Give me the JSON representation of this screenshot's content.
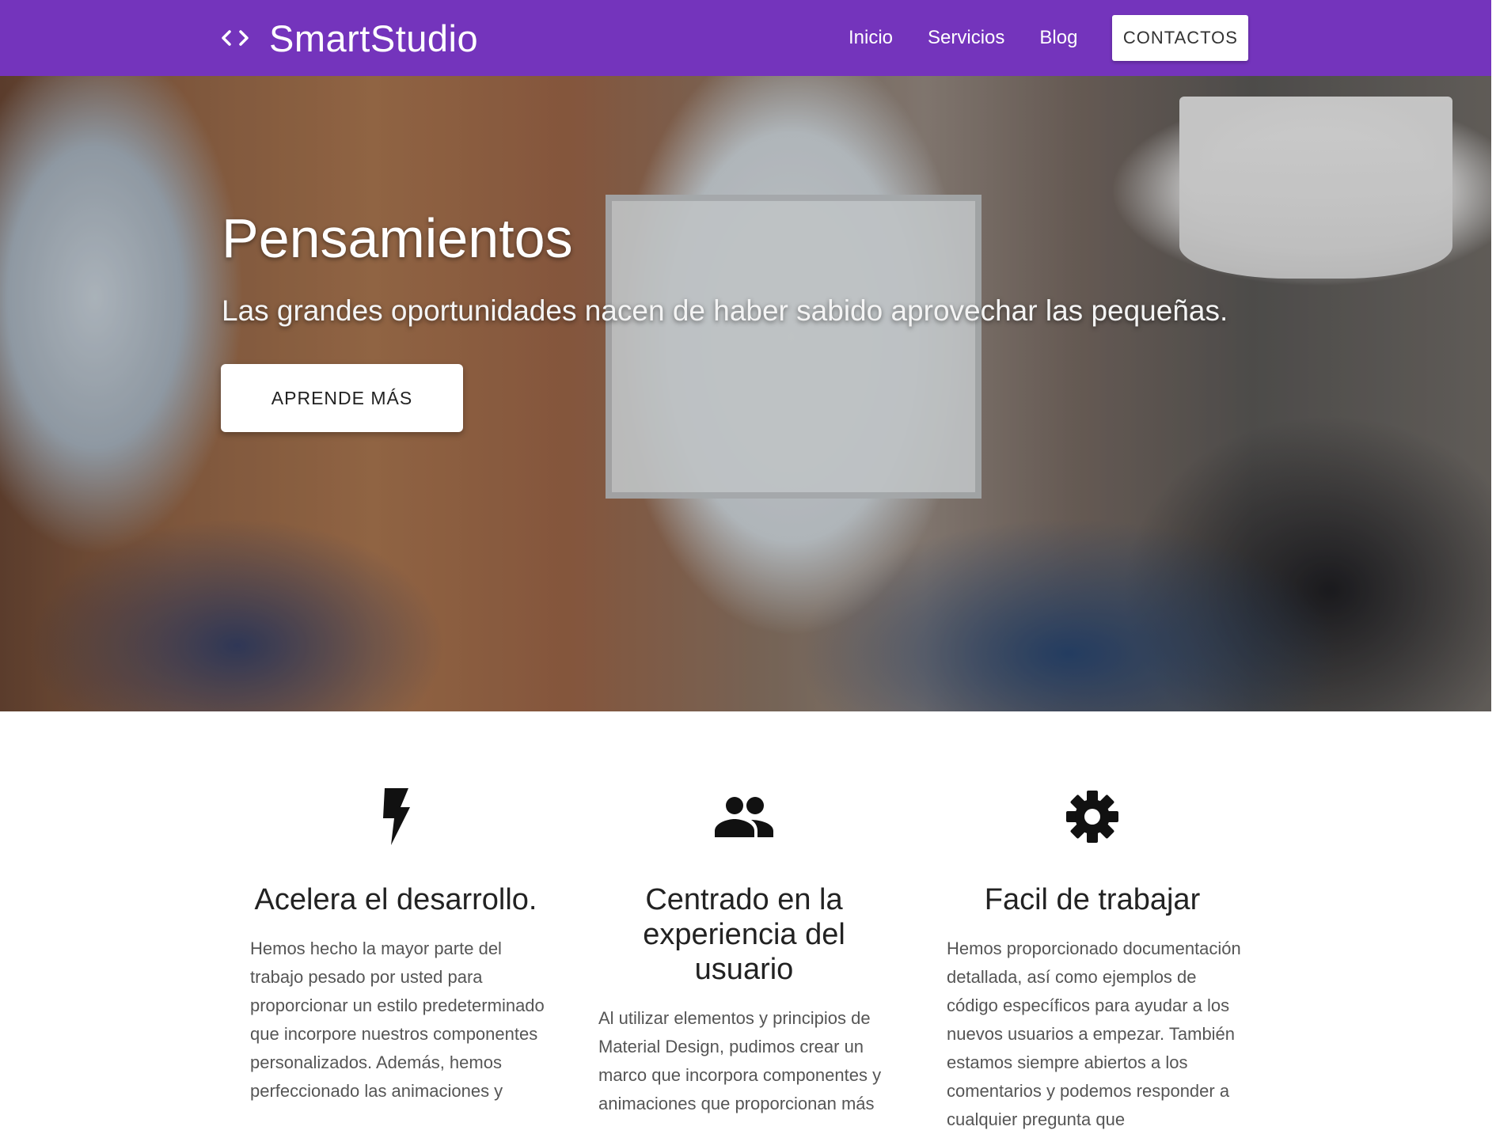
{
  "nav": {
    "brand_name": "SmartStudio",
    "brand_icon": "code-icon",
    "links": [
      "Inicio",
      "Servicios",
      "Blog"
    ],
    "cta_label": "CONTACTOS",
    "background_color": "#7434bc"
  },
  "hero": {
    "title": "Pensamientos",
    "subtitle": "Las grandes oportunidades nacen de haber sabido aprovechar las pequeñas.",
    "button_label": "APRENDE MÁS"
  },
  "features": [
    {
      "icon": "bolt-icon",
      "title": "Acelera el desarrollo.",
      "text": "Hemos hecho la mayor parte del trabajo pesado por usted para proporcionar un estilo predeterminado que incorpore nuestros componentes personalizados. Además, hemos perfeccionado las animaciones y"
    },
    {
      "icon": "group-icon",
      "title": "Centrado en la experiencia del usuario",
      "text": "Al utilizar elementos y principios de Material Design, pudimos crear un marco que incorpora componentes y animaciones que proporcionan más"
    },
    {
      "icon": "gear-icon",
      "title": "Facil de trabajar",
      "text": "Hemos proporcionado documentación detallada, así como ejemplos de código específicos para ayudar a los nuevos usuarios a empezar. También estamos siempre abiertos a los comentarios y podemos responder a cualquier pregunta que"
    }
  ]
}
